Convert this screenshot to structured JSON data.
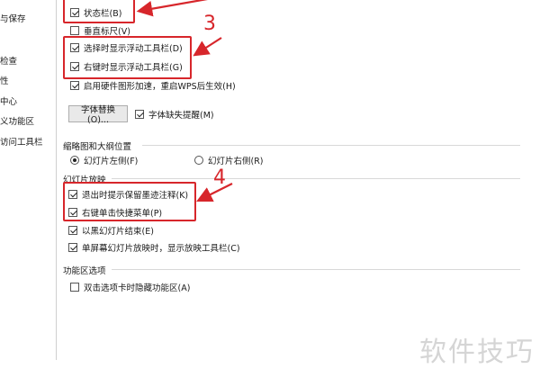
{
  "sidebar": {
    "items": [
      {
        "label": "与保存"
      },
      {
        "label": "检查"
      },
      {
        "label": "性"
      },
      {
        "label": "中心"
      },
      {
        "label": "义功能区"
      },
      {
        "label": "访问工具栏"
      }
    ]
  },
  "options": {
    "status_bar": {
      "label": "状态栏(B)",
      "checked": true
    },
    "vertical_ruler": {
      "label": "垂直标尺(V)",
      "checked": false
    },
    "float_toolbar_select": {
      "label": "选择时显示浮动工具栏(D)",
      "checked": true
    },
    "float_toolbar_rightclick": {
      "label": "右键时显示浮动工具栏(G)",
      "checked": true
    },
    "hw_accel": {
      "label": "启用硬件图形加速，重启WPS后生效(H)",
      "checked": true
    },
    "font_replace_button": "字体替换(O)...",
    "font_missing": {
      "label": "字体缺失提醒(M)",
      "checked": true
    }
  },
  "thumbnail_section": {
    "title": "缩略图和大纲位置",
    "left": {
      "label": "幻灯片左侧(F)",
      "selected": true
    },
    "right": {
      "label": "幻灯片右侧(R)",
      "selected": false
    }
  },
  "slideshow_section": {
    "title": "幻灯片放映",
    "items": [
      {
        "label": "退出时提示保留墨迹注释(K)",
        "checked": true
      },
      {
        "label": "右键单击快捷菜单(P)",
        "checked": true
      },
      {
        "label": "以黑幻灯片结束(E)",
        "checked": true
      },
      {
        "label": "单屏幕幻灯片放映时，显示放映工具栏(C)",
        "checked": true
      }
    ]
  },
  "ribbon_section": {
    "title": "功能区选项",
    "items": [
      {
        "label": "双击选项卡时隐藏功能区(A)",
        "checked": false
      }
    ]
  },
  "annotations": {
    "num3": "3",
    "num4": "4",
    "color": "#d7262b"
  },
  "watermark": "软件技巧"
}
